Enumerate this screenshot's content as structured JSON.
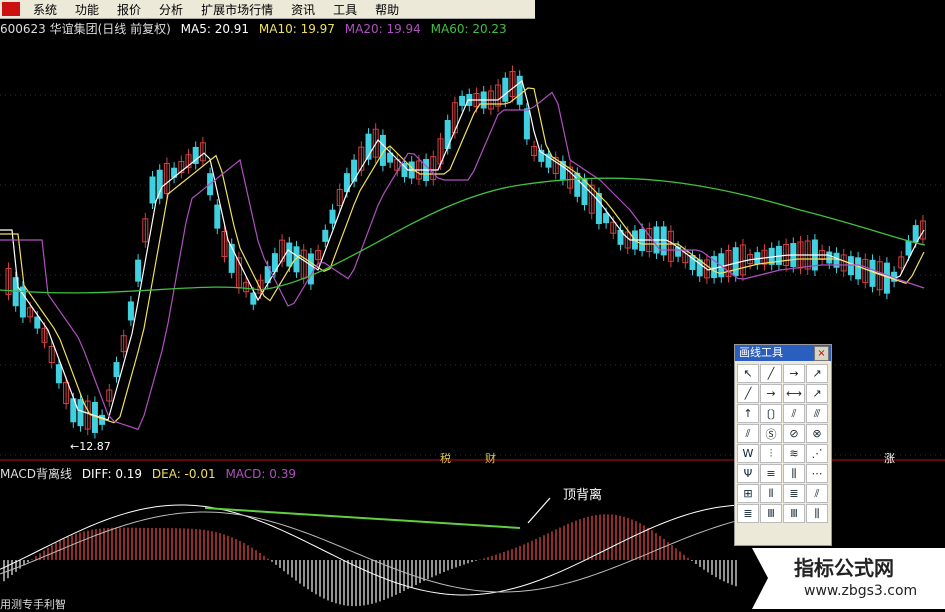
{
  "menu": [
    "系统",
    "功能",
    "报价",
    "分析",
    "扩展市场行情",
    "资讯",
    "工具",
    "帮助"
  ],
  "header": {
    "stock": "600623 华谊集团(日线 前复权)",
    "ma5": "MA5: 20.91",
    "ma10": "MA10: 19.97",
    "ma20": "MA20: 19.94",
    "ma60": "MA60: 20.23"
  },
  "colors": {
    "ma5": "#ffffff",
    "ma10": "#f0e060",
    "ma20": "#b050c0",
    "ma60": "#40c040",
    "up": "#d04040",
    "down": "#40d0e0",
    "signal": "#c01010"
  },
  "low_label": "←12.87",
  "macd": {
    "title": "MACD背离线",
    "diff": "DIFF: 0.19",
    "dea": "DEA: -0.01",
    "macd": "MACD: 0.39"
  },
  "annotation": "顶背离",
  "indicator_marks": [
    "税",
    "财",
    "涨"
  ],
  "bottom_text": "用测专手利智",
  "toolbox": {
    "title": "画线工具",
    "close": "×",
    "tools": [
      "↖",
      "╱",
      "→",
      "↗",
      "╱",
      "→",
      "⟷",
      "↗",
      "↑",
      "〔〕",
      "⫽",
      "⫻",
      "⫽",
      "Ⓢ",
      "⊘",
      "⊗",
      "W",
      "⫶",
      "≋",
      "⋰",
      "Ψ",
      "≡",
      "⫼",
      "⋯",
      "⊞",
      "⫴",
      "≣",
      "⫽",
      "≣",
      "Ⅲ",
      "Ⅲ",
      "⫼"
    ]
  },
  "watermark": {
    "title": "指标公式网",
    "url": "www.zbgs3.com"
  }
}
